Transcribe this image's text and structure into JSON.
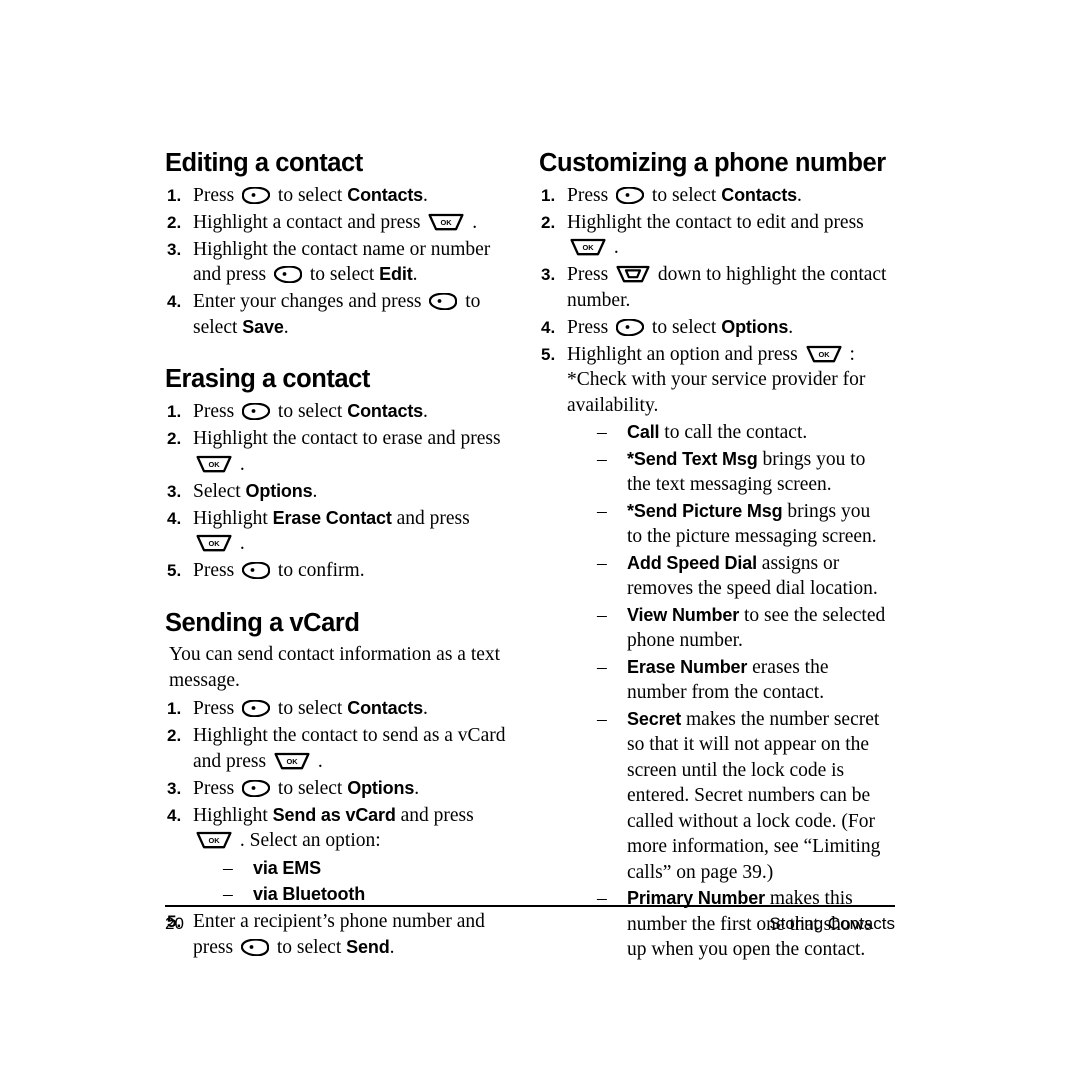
{
  "page": {
    "number": "20",
    "running_head": "Storing Contacts"
  },
  "icons": {
    "left_softkey": "left-softkey-icon",
    "right_softkey": "right-softkey-icon",
    "ok_key": "ok-key-icon",
    "ok_label": "OK",
    "navigation_key": "navigation-key-icon"
  },
  "left_column": {
    "sections": [
      {
        "title": "Editing a contact",
        "steps": [
          {
            "num": "1.",
            "parts": [
              {
                "t": "text",
                "v": "Press "
              },
              {
                "t": "key",
                "v": "left_softkey"
              },
              {
                "t": "text",
                "v": " to select "
              },
              {
                "t": "bold",
                "v": "Contacts"
              },
              {
                "t": "text",
                "v": "."
              }
            ]
          },
          {
            "num": "2.",
            "parts": [
              {
                "t": "text",
                "v": "Highlight a contact and press "
              },
              {
                "t": "key",
                "v": "ok_key"
              },
              {
                "t": "text",
                "v": " ."
              }
            ]
          },
          {
            "num": "3.",
            "parts": [
              {
                "t": "text",
                "v": "Highlight the contact name or number and press "
              },
              {
                "t": "key",
                "v": "right_softkey"
              },
              {
                "t": "text",
                "v": " to select "
              },
              {
                "t": "bold",
                "v": "Edit"
              },
              {
                "t": "text",
                "v": "."
              }
            ]
          },
          {
            "num": "4.",
            "parts": [
              {
                "t": "text",
                "v": "Enter your changes and press "
              },
              {
                "t": "key",
                "v": "right_softkey"
              },
              {
                "t": "text",
                "v": " to select "
              },
              {
                "t": "bold",
                "v": "Save"
              },
              {
                "t": "text",
                "v": "."
              }
            ]
          }
        ]
      },
      {
        "title": "Erasing a contact",
        "steps": [
          {
            "num": "1.",
            "parts": [
              {
                "t": "text",
                "v": "Press "
              },
              {
                "t": "key",
                "v": "left_softkey"
              },
              {
                "t": "text",
                "v": " to select "
              },
              {
                "t": "bold",
                "v": "Contacts"
              },
              {
                "t": "text",
                "v": "."
              }
            ]
          },
          {
            "num": "2.",
            "parts": [
              {
                "t": "text",
                "v": "Highlight the contact to erase and press "
              },
              {
                "t": "key",
                "v": "ok_key"
              },
              {
                "t": "text",
                "v": " ."
              }
            ]
          },
          {
            "num": "3.",
            "parts": [
              {
                "t": "text",
                "v": "Select "
              },
              {
                "t": "bold",
                "v": "Options"
              },
              {
                "t": "text",
                "v": "."
              }
            ]
          },
          {
            "num": "4.",
            "parts": [
              {
                "t": "text",
                "v": "Highlight "
              },
              {
                "t": "bold",
                "v": "Erase Contact"
              },
              {
                "t": "text",
                "v": " and press "
              },
              {
                "t": "key",
                "v": "ok_key"
              },
              {
                "t": "text",
                "v": " ."
              }
            ]
          },
          {
            "num": "5.",
            "parts": [
              {
                "t": "text",
                "v": "Press "
              },
              {
                "t": "key",
                "v": "right_softkey"
              },
              {
                "t": "text",
                "v": " to confirm."
              }
            ]
          }
        ]
      },
      {
        "title": "Sending a vCard",
        "intro": "You can send contact information as a text message.",
        "steps": [
          {
            "num": "1.",
            "parts": [
              {
                "t": "text",
                "v": "Press "
              },
              {
                "t": "key",
                "v": "left_softkey"
              },
              {
                "t": "text",
                "v": " to select "
              },
              {
                "t": "bold",
                "v": "Contacts"
              },
              {
                "t": "text",
                "v": "."
              }
            ]
          },
          {
            "num": "2.",
            "parts": [
              {
                "t": "text",
                "v": "Highlight the contact to send as a vCard and press "
              },
              {
                "t": "key",
                "v": "ok_key"
              },
              {
                "t": "text",
                "v": " ."
              }
            ]
          },
          {
            "num": "3.",
            "parts": [
              {
                "t": "text",
                "v": "Press "
              },
              {
                "t": "key",
                "v": "left_softkey"
              },
              {
                "t": "text",
                "v": " to select "
              },
              {
                "t": "bold",
                "v": "Options"
              },
              {
                "t": "text",
                "v": "."
              }
            ]
          },
          {
            "num": "4.",
            "parts": [
              {
                "t": "text",
                "v": "Highlight "
              },
              {
                "t": "bold",
                "v": "Send as vCard"
              },
              {
                "t": "text",
                "v": " and press "
              },
              {
                "t": "key",
                "v": "ok_key"
              },
              {
                "t": "text",
                "v": " . Select an option:"
              }
            ],
            "sublist": [
              [
                {
                  "t": "bold",
                  "v": "via EMS"
                }
              ],
              [
                {
                  "t": "bold",
                  "v": "via Bluetooth"
                }
              ]
            ]
          },
          {
            "num": "5.",
            "parts": [
              {
                "t": "text",
                "v": "Enter a recipient’s phone number and press "
              },
              {
                "t": "key",
                "v": "right_softkey"
              },
              {
                "t": "text",
                "v": " to select "
              },
              {
                "t": "bold",
                "v": "Send"
              },
              {
                "t": "text",
                "v": "."
              }
            ]
          }
        ]
      }
    ]
  },
  "right_column": {
    "sections": [
      {
        "title": "Customizing a phone number",
        "steps": [
          {
            "num": "1.",
            "parts": [
              {
                "t": "text",
                "v": "Press "
              },
              {
                "t": "key",
                "v": "left_softkey"
              },
              {
                "t": "text",
                "v": " to select "
              },
              {
                "t": "bold",
                "v": "Contacts"
              },
              {
                "t": "text",
                "v": "."
              }
            ]
          },
          {
            "num": "2.",
            "parts": [
              {
                "t": "text",
                "v": "Highlight the contact to edit and press "
              },
              {
                "t": "key",
                "v": "ok_key"
              },
              {
                "t": "text",
                "v": " ."
              }
            ]
          },
          {
            "num": "3.",
            "parts": [
              {
                "t": "text",
                "v": "Press "
              },
              {
                "t": "key",
                "v": "navigation_key"
              },
              {
                "t": "text",
                "v": " down to highlight the contact number."
              }
            ]
          },
          {
            "num": "4.",
            "parts": [
              {
                "t": "text",
                "v": "Press "
              },
              {
                "t": "key",
                "v": "left_softkey"
              },
              {
                "t": "text",
                "v": " to select "
              },
              {
                "t": "bold",
                "v": "Options"
              },
              {
                "t": "text",
                "v": "."
              }
            ]
          },
          {
            "num": "5.",
            "parts": [
              {
                "t": "text",
                "v": "Highlight an option and press "
              },
              {
                "t": "key",
                "v": "ok_key"
              },
              {
                "t": "text",
                "v": " :"
              },
              {
                "t": "break",
                "v": ""
              },
              {
                "t": "text",
                "v": "*Check with your service provider for availability."
              }
            ],
            "sublist": [
              [
                {
                  "t": "bold",
                  "v": "Call"
                },
                {
                  "t": "text",
                  "v": " to call the contact."
                }
              ],
              [
                {
                  "t": "bold",
                  "v": "*Send Text Msg"
                },
                {
                  "t": "text",
                  "v": " brings you to the text messaging screen."
                }
              ],
              [
                {
                  "t": "bold",
                  "v": "*Send Picture Msg"
                },
                {
                  "t": "text",
                  "v": " brings you to the picture messaging screen."
                }
              ],
              [
                {
                  "t": "bold",
                  "v": "Add Speed Dial"
                },
                {
                  "t": "text",
                  "v": " assigns or removes the speed dial location."
                }
              ],
              [
                {
                  "t": "bold",
                  "v": "View Number"
                },
                {
                  "t": "text",
                  "v": " to see the selected phone number."
                }
              ],
              [
                {
                  "t": "bold",
                  "v": "Erase Number"
                },
                {
                  "t": "text",
                  "v": " erases the number from the contact."
                }
              ],
              [
                {
                  "t": "bold",
                  "v": "Secret"
                },
                {
                  "t": "text",
                  "v": " makes the number secret so that it will not appear on the screen until the lock code is entered. Secret numbers can be called without a lock code. (For more information, see “Limiting calls” on page 39.)"
                }
              ],
              [
                {
                  "t": "bold",
                  "v": "Primary Number"
                },
                {
                  "t": "text",
                  "v": " makes this number the first one that shows up when you open the contact."
                }
              ]
            ]
          }
        ]
      }
    ]
  }
}
